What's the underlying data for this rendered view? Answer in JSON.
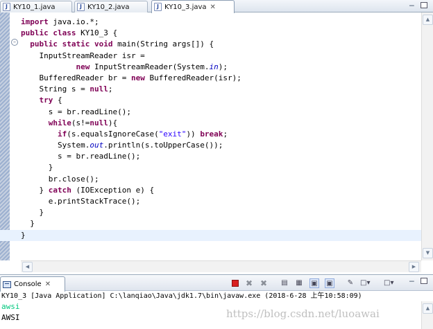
{
  "editor": {
    "tabs": [
      {
        "label": "KY10_1.java",
        "active": false
      },
      {
        "label": "KY10_2.java",
        "active": false
      },
      {
        "label": "KY10_3.java",
        "active": true
      }
    ],
    "tab_close_glyph": "✕",
    "code_lines": [
      [
        {
          "t": "kw",
          "v": "import"
        },
        {
          "t": "n",
          "v": " java.io.*;"
        }
      ],
      [
        {
          "t": "kw",
          "v": "public class"
        },
        {
          "t": "n",
          "v": " KY10_3 {"
        }
      ],
      [
        {
          "t": "n",
          "v": "  "
        },
        {
          "t": "kw",
          "v": "public static void"
        },
        {
          "t": "n",
          "v": " main(String args[]) {"
        }
      ],
      [
        {
          "t": "n",
          "v": "    InputStreamReader isr ="
        }
      ],
      [
        {
          "t": "n",
          "v": "            "
        },
        {
          "t": "kw",
          "v": "new"
        },
        {
          "t": "n",
          "v": " InputStreamReader(System."
        },
        {
          "t": "stat",
          "v": "in"
        },
        {
          "t": "n",
          "v": ");"
        }
      ],
      [
        {
          "t": "n",
          "v": "    BufferedReader br = "
        },
        {
          "t": "kw",
          "v": "new"
        },
        {
          "t": "n",
          "v": " BufferedReader(isr);"
        }
      ],
      [
        {
          "t": "n",
          "v": "    String s = "
        },
        {
          "t": "kw",
          "v": "null"
        },
        {
          "t": "n",
          "v": ";"
        }
      ],
      [
        {
          "t": "n",
          "v": "    "
        },
        {
          "t": "kw",
          "v": "try"
        },
        {
          "t": "n",
          "v": " {"
        }
      ],
      [
        {
          "t": "n",
          "v": "      s = br.readLine();"
        }
      ],
      [
        {
          "t": "n",
          "v": "      "
        },
        {
          "t": "kw",
          "v": "while"
        },
        {
          "t": "n",
          "v": "(s!="
        },
        {
          "t": "kw",
          "v": "null"
        },
        {
          "t": "n",
          "v": "){"
        }
      ],
      [
        {
          "t": "n",
          "v": "        "
        },
        {
          "t": "kw",
          "v": "if"
        },
        {
          "t": "n",
          "v": "(s.equalsIgnoreCase("
        },
        {
          "t": "str",
          "v": "\"exit\""
        },
        {
          "t": "n",
          "v": ")) "
        },
        {
          "t": "kw",
          "v": "break"
        },
        {
          "t": "n",
          "v": ";"
        }
      ],
      [
        {
          "t": "n",
          "v": "        System."
        },
        {
          "t": "stat",
          "v": "out"
        },
        {
          "t": "n",
          "v": ".println(s.toUpperCase());"
        }
      ],
      [
        {
          "t": "n",
          "v": "        s = br.readLine();"
        }
      ],
      [
        {
          "t": "n",
          "v": "      }"
        }
      ],
      [
        {
          "t": "n",
          "v": "      br.close();"
        }
      ],
      [
        {
          "t": "n",
          "v": "    } "
        },
        {
          "t": "kw",
          "v": "catch"
        },
        {
          "t": "n",
          "v": " (IOException e) {"
        }
      ],
      [
        {
          "t": "n",
          "v": "      e.printStackTrace();"
        }
      ],
      [
        {
          "t": "n",
          "v": "    }"
        }
      ],
      [
        {
          "t": "n",
          "v": "  }"
        }
      ],
      [
        {
          "t": "n",
          "v": "}"
        }
      ]
    ],
    "current_line_index": 19
  },
  "console": {
    "tab_label": "Console",
    "tab_close_glyph": "✕",
    "header": "KY10_3 [Java Application] C:\\lanqiao\\Java\\jdk1.7\\bin\\javaw.exe (2018-6-28 上午10:58:09)",
    "lines": [
      {
        "kind": "input",
        "text": "awsi"
      },
      {
        "kind": "output",
        "text": "AWSI"
      }
    ]
  },
  "watermark": "https://blog.csdn.net/luoawai",
  "colors": {
    "keyword": "#7f0055",
    "string": "#2a00ff",
    "static_field": "#0000c0",
    "console_input": "#00c87d",
    "current_line": "#e8f2fe"
  },
  "icons": {
    "tab_file": "java-file-icon",
    "console": "console-icon",
    "minimize": "minimize-icon",
    "maximize": "maximize-icon"
  }
}
